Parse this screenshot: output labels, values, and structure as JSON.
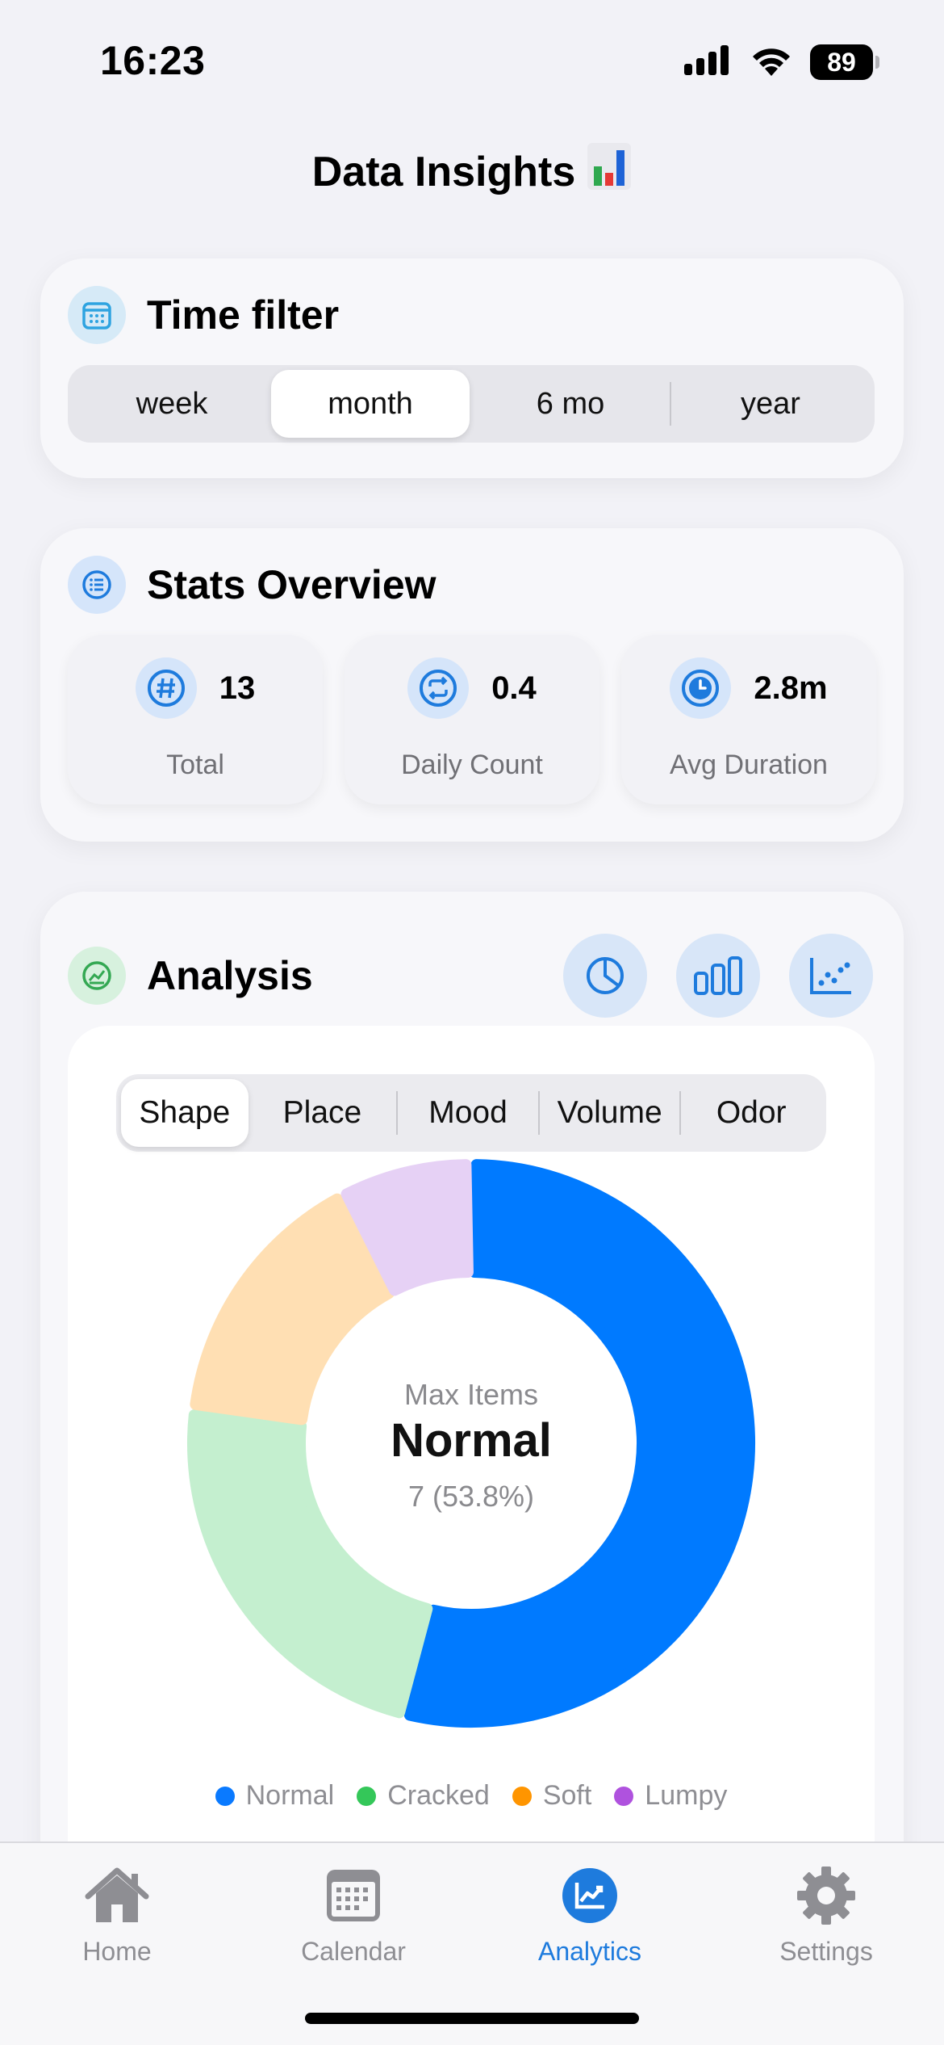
{
  "status": {
    "time": "16:23",
    "battery": "89"
  },
  "page": {
    "title": "Data Insights",
    "title_icon": "bar-chart-emoji"
  },
  "time_filter": {
    "title": "Time filter",
    "icon": "calendar-icon",
    "options": [
      "week",
      "month",
      "6 mo",
      "year"
    ],
    "selected": "month"
  },
  "stats": {
    "title": "Stats Overview",
    "icon": "list-icon",
    "items": [
      {
        "icon": "hash-icon",
        "value": "13",
        "label": "Total"
      },
      {
        "icon": "repeat-icon",
        "value": "0.4",
        "label": "Daily Count"
      },
      {
        "icon": "clock-icon",
        "value": "2.8m",
        "label": "Avg Duration"
      }
    ]
  },
  "analysis": {
    "title": "Analysis",
    "icon": "trend-chart-icon",
    "chart_buttons": [
      "pie-chart-icon",
      "bar-chart-icon",
      "scatter-chart-icon"
    ],
    "tabs": [
      "Shape",
      "Place",
      "Mood",
      "Volume",
      "Odor"
    ],
    "selected_tab": "Shape",
    "center_caption": "Max Items",
    "center_name": "Normal",
    "center_value": "7 (53.8%)"
  },
  "chart_data": {
    "type": "pie",
    "variant": "donut",
    "categories": [
      "Normal",
      "Cracked",
      "Soft",
      "Lumpy"
    ],
    "values": [
      7,
      3,
      2,
      1
    ],
    "colors": [
      "#007AFF",
      "#C4EFCF",
      "#FFDFB3",
      "#E6D1F5"
    ],
    "legend_colors": [
      "#0A7AFF",
      "#34C759",
      "#FF9500",
      "#AF52DE"
    ],
    "legend_position": "bottom"
  },
  "tab_bar": {
    "items": [
      {
        "label": "Home",
        "icon": "house-icon"
      },
      {
        "label": "Calendar",
        "icon": "calendar-icon"
      },
      {
        "label": "Analytics",
        "icon": "analytics-icon"
      },
      {
        "label": "Settings",
        "icon": "gear-icon"
      }
    ],
    "selected": "Analytics"
  },
  "colors": {
    "accent": "#007AFF",
    "tab_active": "#1E7BDD",
    "tab_inactive": "#8E8E93"
  }
}
